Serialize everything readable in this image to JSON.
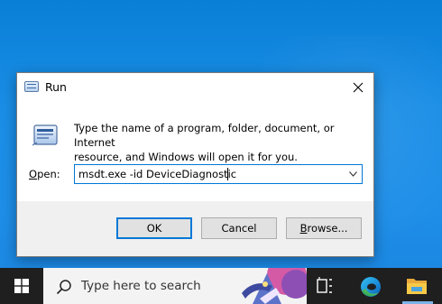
{
  "dialog": {
    "title": "Run",
    "prompt_line1": "Type the name of a program, folder, document, or Internet",
    "prompt_line2": "resource, and Windows will open it for you.",
    "open_label_prefix": "",
    "open_label_underlined": "O",
    "open_label_rest": "pen:",
    "open_value": "msdt.exe -id DeviceDiagnostic",
    "buttons": {
      "ok": "OK",
      "cancel": "Cancel",
      "browse_underlined": "B",
      "browse_rest": "rowse..."
    }
  },
  "taskbar": {
    "search_placeholder": "Type here to search"
  },
  "colors": {
    "accent": "#0078d7",
    "desktop": "#1a8ee6",
    "taskbar": "#1f1f1f"
  },
  "icons": [
    "run-icon",
    "close-icon",
    "chevron-down-icon",
    "windows-logo-icon",
    "search-icon",
    "task-view-icon",
    "edge-icon",
    "file-explorer-icon"
  ]
}
